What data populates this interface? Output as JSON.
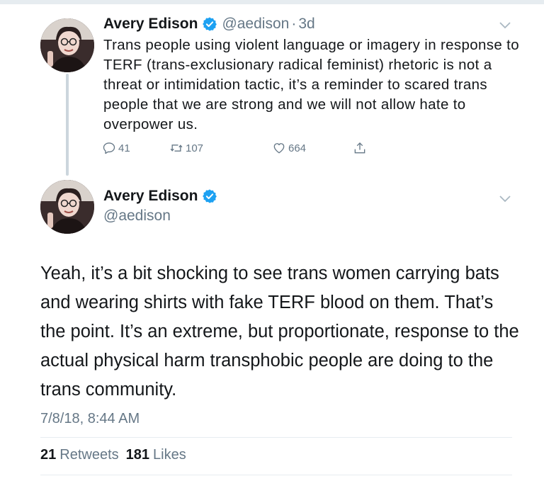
{
  "colors": {
    "text": "#14171a",
    "muted": "#657786",
    "verified": "#1da1f2",
    "divider": "#e6ecf0"
  },
  "tweet1": {
    "display_name": "Avery Edison",
    "handle": "@aedison",
    "separator": "·",
    "age": "3d",
    "text": "Trans people using violent language or imagery in response to TERF (trans-exclusionary radical feminist) rhetoric is not a threat or intimidation tactic, it’s a reminder to scared trans people that we are strong and we will not allow hate to overpower us.",
    "reply_count": "41",
    "retweet_count": "107",
    "like_count": "664",
    "icons": [
      "reply-icon",
      "retweet-icon",
      "heart-icon",
      "share-icon",
      "chevron-down-icon",
      "verified-badge-icon"
    ]
  },
  "tweet2": {
    "display_name": "Avery Edison",
    "handle": "@aedison",
    "text": "Yeah, it’s a bit shocking to see trans women carrying bats and wearing shirts with fake TERF blood on them. That’s the point. It’s an extreme, but proportionate, response to the actual physical harm transphobic people are doing to the trans community.",
    "timestamp": "7/8/18, 8:44 AM",
    "retweets_count": "21",
    "retweets_label": "Retweets",
    "likes_count": "181",
    "likes_label": "Likes"
  }
}
